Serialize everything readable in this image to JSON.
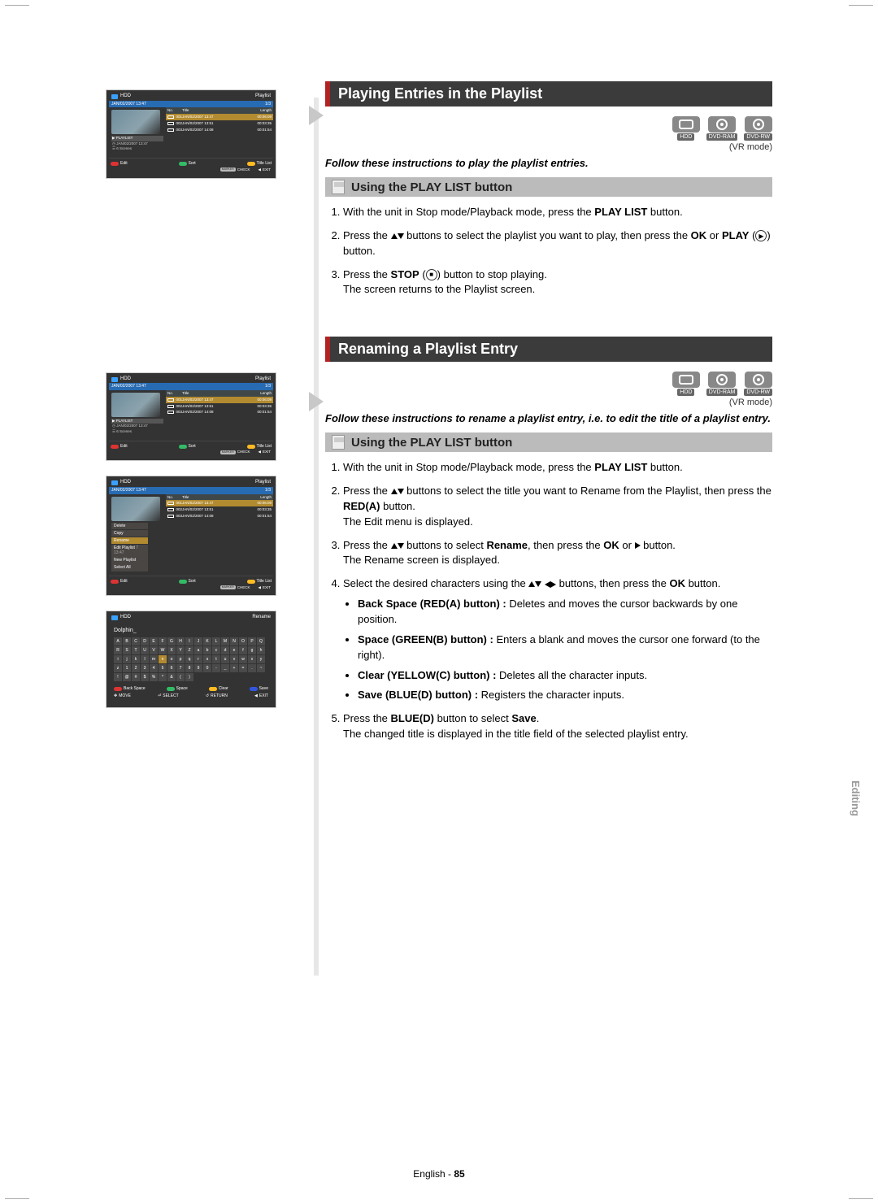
{
  "sidebar": {
    "section": "Editing"
  },
  "footer": {
    "lang": "English",
    "page": "85"
  },
  "screenshots": {
    "common": {
      "hdd": "HDD",
      "playlist": "Playlist",
      "timestamp": "JAN/02/2007 13:47",
      "count": "1/3",
      "table": {
        "no": "No.",
        "title": "Title",
        "length": "Length"
      },
      "rows": [
        {
          "no": "001",
          "title": "JAN/02/2007 13:47",
          "length": "00:06:09"
        },
        {
          "no": "002",
          "title": "JAN/02/2007 13:51",
          "length": "00:03:35"
        },
        {
          "no": "003",
          "title": "JAN/02/2007 14:08",
          "length": "00:01:54"
        }
      ],
      "leftinfo": {
        "playlist": "PLAYLIST",
        "date": "JAN/02/2007 13:47",
        "scenes": "6 Scenes"
      },
      "footerA": {
        "edit": "Edit",
        "sort": "Sort",
        "titlelist": "Title List",
        "marker": "MARKER",
        "check": "CHECK",
        "exit": "EXIT"
      }
    },
    "menu": {
      "items": [
        "Delete",
        "Copy",
        "Rename",
        "Edit Playlist",
        "New Playlist",
        "Select All"
      ],
      "rowfrag": "7 13:47"
    },
    "rename": {
      "label": "Rename",
      "input": "Dolphin_",
      "keys": [
        "A",
        "B",
        "C",
        "D",
        "E",
        "F",
        "G",
        "H",
        "I",
        "J",
        "K",
        "L",
        "M",
        "N",
        "O",
        "P",
        "Q",
        "R",
        "S",
        "T",
        "U",
        "V",
        "W",
        "X",
        "Y",
        "Z",
        "a",
        "b",
        "c",
        "d",
        "e",
        "f",
        "g",
        "h",
        "i",
        "j",
        "k",
        "l",
        "m",
        "n",
        "o",
        "p",
        "q",
        "r",
        "s",
        "t",
        "u",
        "v",
        "w",
        "x",
        "y",
        "z",
        "1",
        "2",
        "3",
        "4",
        "5",
        "6",
        "7",
        "8",
        "9",
        "0",
        "-",
        "_",
        "+",
        "=",
        ".",
        "~",
        "!",
        "@",
        "#",
        "$",
        "%",
        "^",
        "&",
        "(",
        ")"
      ],
      "footer": {
        "back": "Back Space",
        "space": "Space",
        "clear": "Clear",
        "save": "Save",
        "move": "MOVE",
        "select": "SELECT",
        "return": "RETURN",
        "exit": "EXIT"
      }
    }
  },
  "sections": {
    "s1": {
      "title": "Playing Entries in the Playlist",
      "mode": "(VR mode)",
      "follow": "Follow these instructions to play the playlist entries.",
      "sub": "Using the PLAY LIST button",
      "steps": {
        "l1a": "With the unit in Stop mode/Playback mode, press the ",
        "l1b": "PLAY LIST",
        "l1c": " button.",
        "l2a": "Press the ",
        "l2b": " buttons to select the playlist you want to play, then press the ",
        "l2c": "OK",
        "l2d": " or ",
        "l2e": "PLAY",
        "l2f": " button.",
        "l3a": "Press the ",
        "l3b": "STOP",
        "l3c": " button to stop playing.",
        "l3d": "The screen returns to the Playlist screen."
      }
    },
    "s2": {
      "title": "Renaming a Playlist Entry",
      "mode": "(VR mode)",
      "follow": "Follow these instructions to rename a playlist entry, i.e. to edit the title of a playlist entry.",
      "sub": "Using the PLAY LIST button",
      "steps": {
        "l1a": "With the unit in Stop mode/Playback mode, press the ",
        "l1b": "PLAY LIST",
        "l1c": " button.",
        "l2a": "Press the ",
        "l2b": " buttons to select the title you want to Rename from the Playlist, then press the ",
        "l2c": "RED(A)",
        "l2d": " button.",
        "l2e": "The Edit menu is displayed.",
        "l3a": "Press the ",
        "l3b": " buttons to select ",
        "l3c": "Rename",
        "l3d": ", then press the ",
        "l3e": "OK",
        "l3f": " or ",
        "l3g": " button.",
        "l3h": "The Rename screen is displayed.",
        "l4a": "Select the desired characters using the ",
        "l4b": " buttons, then press the ",
        "l4c": "OK",
        "l4d": " button.",
        "b1a": "Back Space (RED(A) button) :",
        "b1b": " Deletes and moves the cursor backwards by one position.",
        "b2a": "Space (GREEN(B) button) :",
        "b2b": " Enters a blank and moves the cursor one forward (to the right).",
        "b3a": "Clear (YELLOW(C) button) :",
        "b3b": " Deletes all the character inputs.",
        "b4a": "Save (BLUE(D) button) :",
        "b4b": " Registers the character inputs.",
        "l5a": "Press the ",
        "l5b": "BLUE(D)",
        "l5c": " button to select ",
        "l5d": "Save",
        "l5e": ".",
        "l5f": "The changed title is displayed in the title field of the selected playlist entry."
      }
    }
  },
  "media": {
    "hdd": "HDD",
    "ram": "DVD-RAM",
    "rw": "DVD-RW"
  }
}
